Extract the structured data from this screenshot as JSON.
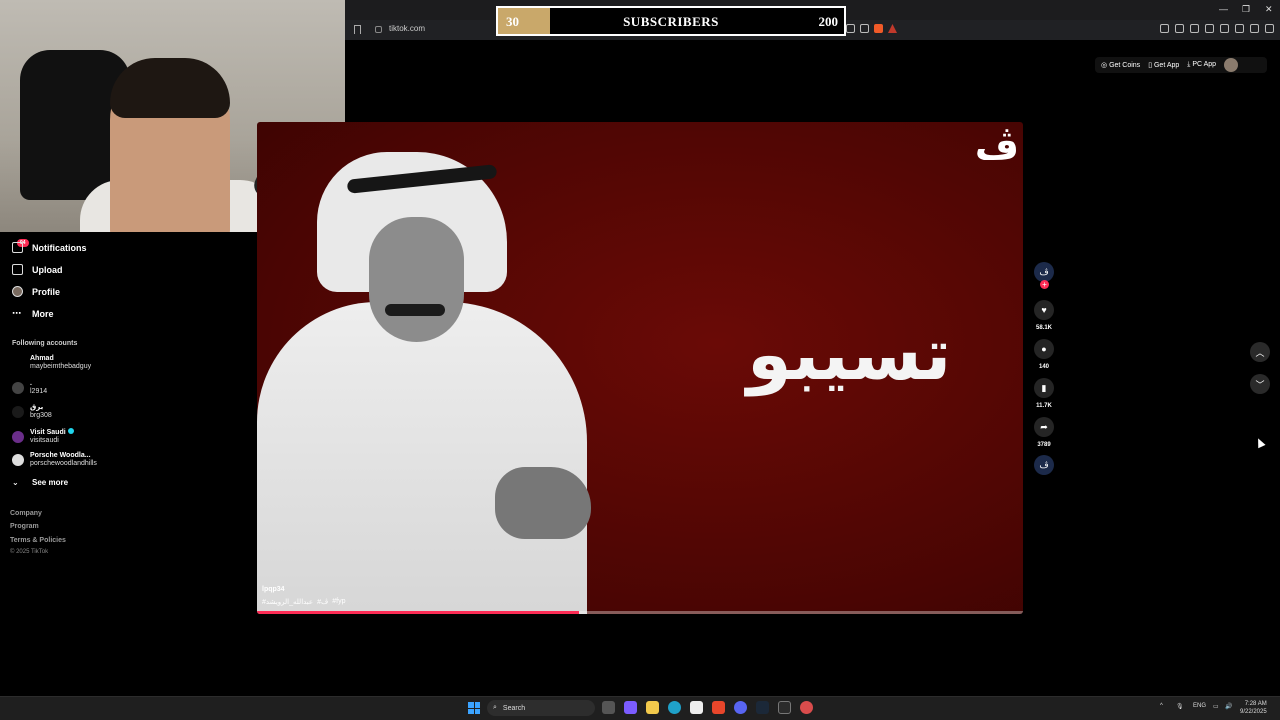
{
  "browser": {
    "url": "tiktok.com"
  },
  "subscriber_goal": {
    "current": "30",
    "label": "SUBSCRIBERS",
    "goal": "200",
    "progress_fraction": 0.15
  },
  "tiktok_header": {
    "get_coins": "Get Coins",
    "get_app": "Get App",
    "pc_app": "PC App"
  },
  "sidebar": {
    "notifications_badge": "94",
    "items": [
      {
        "label": "Notifications",
        "icon": "bell-icon"
      },
      {
        "label": "Upload",
        "icon": "plus-square-icon"
      },
      {
        "label": "Profile",
        "icon": "avatar"
      },
      {
        "label": "More",
        "icon": "ellipsis-icon"
      }
    ],
    "following_heading": "Following accounts",
    "accounts": [
      {
        "name": "Ahmad",
        "handle": "maybeimthebadguy"
      },
      {
        "name": ".",
        "handle": "l2914"
      },
      {
        "name": "برق",
        "handle": "brg308"
      },
      {
        "name": "Visit Saudi",
        "handle": "visitsaudi",
        "verified": true
      },
      {
        "name": "Porsche Woodla...",
        "handle": "porschewoodlandhills"
      }
    ],
    "see_more": "See more",
    "footer": [
      "Company",
      "Program",
      "Terms & Policies"
    ],
    "copyright": "© 2025 TikTok"
  },
  "video": {
    "overlay_text": "تسيبو",
    "logo_text": "ڤ",
    "username": "lpqp34",
    "hashtags": [
      "#عبدالله_الرويشد",
      "#ڤ",
      "#fyp"
    ],
    "progress_fraction": 0.42
  },
  "actions": {
    "creator_avatar_text": "ڤ",
    "likes": "58.1K",
    "comments": "140",
    "saves": "11.7K",
    "shares": "3789",
    "sound_avatar_text": "ڤ"
  },
  "taskbar": {
    "search_placeholder": "Search",
    "language": "ENG",
    "time": "7:28 AM",
    "date": "9/22/2025"
  },
  "colors": {
    "tiktok_red": "#fe2c55",
    "goal_fill": "#c9a86a",
    "video_bg": "#4a0503"
  }
}
